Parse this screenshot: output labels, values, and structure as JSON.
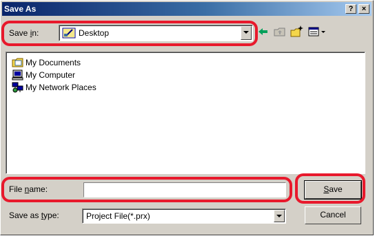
{
  "window": {
    "title": "Save As"
  },
  "titlebar_buttons": {
    "help": "?",
    "close": "×"
  },
  "save_in": {
    "label_pre": "Save ",
    "label_key": "i",
    "label_post": "n:",
    "value": "Desktop"
  },
  "toolbar": {
    "icons": [
      "back-icon",
      "up-folder-icon",
      "new-folder-icon",
      "view-menu-icon"
    ]
  },
  "file_list": [
    {
      "label": "My Documents",
      "icon": "my-documents-icon"
    },
    {
      "label": "My Computer",
      "icon": "my-computer-icon"
    },
    {
      "label": "My Network Places",
      "icon": "network-places-icon"
    }
  ],
  "file_name": {
    "label_pre": "File ",
    "label_key": "n",
    "label_post": "ame:",
    "value": ""
  },
  "save_as_type": {
    "label_pre": "Save as ",
    "label_key": "t",
    "label_post": "ype:",
    "value": "Project File(*.prx)"
  },
  "buttons": {
    "save_key": "S",
    "save_rest": "ave",
    "cancel": "Cancel"
  },
  "colors": {
    "highlight": "#e8192c",
    "titlebar_start": "#0a246a",
    "titlebar_end": "#a6caf0"
  }
}
